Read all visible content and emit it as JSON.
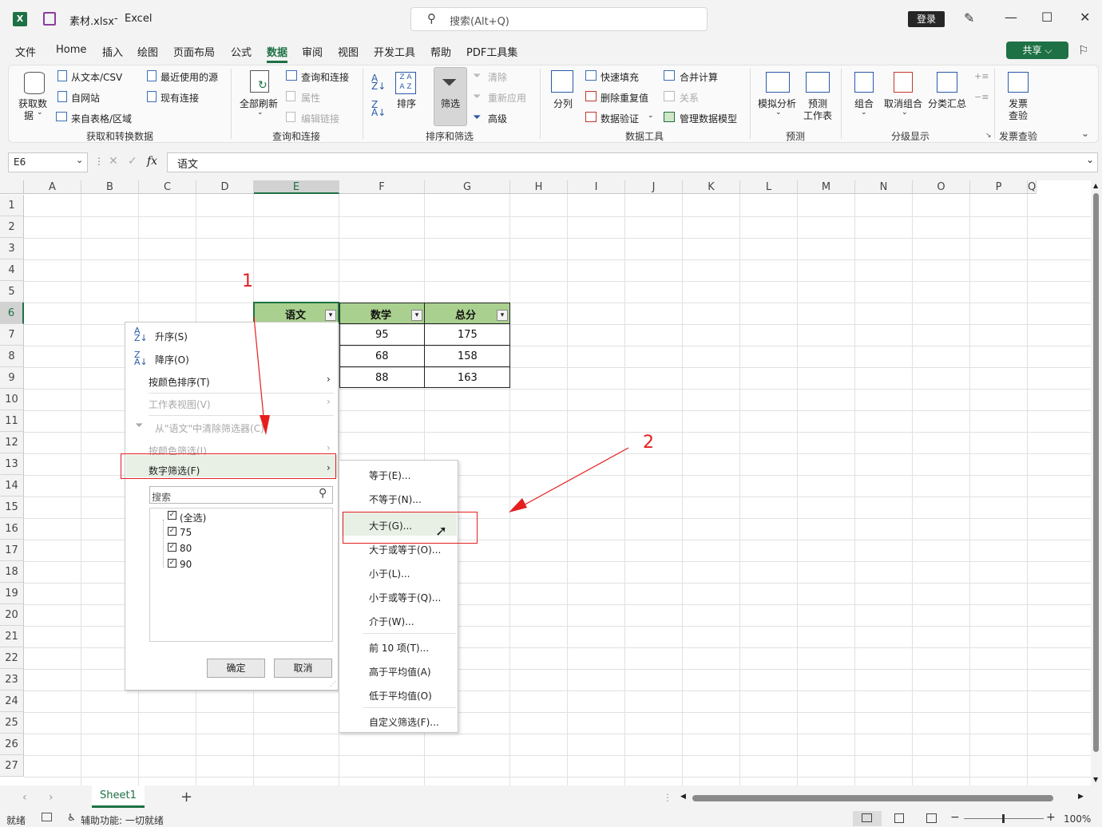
{
  "titlebar": {
    "filename": "素材.xlsx",
    "separator": "-",
    "app": "Excel",
    "search_placeholder": "搜索(Alt+Q)",
    "login": "登录"
  },
  "menu": [
    "文件",
    "Home",
    "插入",
    "绘图",
    "页面布局",
    "公式",
    "数据",
    "审阅",
    "视图",
    "开发工具",
    "帮助",
    "PDF工具集"
  ],
  "share": "共享",
  "ribbon": {
    "get_data": "获取数",
    "get_data2": "据",
    "from_text": "从文本/CSV",
    "from_web": "自网站",
    "from_table": "来自表格/区域",
    "recent_sources": "最近使用的源",
    "existing_conn": "现有连接",
    "group_get": "获取和转换数据",
    "refresh_all": "全部刷新",
    "queries_conn": "查询和连接",
    "properties": "属性",
    "edit_links": "编辑链接",
    "group_query": "查询和连接",
    "sort": "排序",
    "filter": "筛选",
    "clear": "清除",
    "reapply": "重新应用",
    "advanced": "高级",
    "group_sort": "排序和筛选",
    "text_to_col": "分列",
    "flash_fill": "快速填充",
    "remove_dup": "删除重复值",
    "data_valid": "数据验证",
    "consolidate": "合并计算",
    "relations": "关系",
    "manage_model": "管理数据模型",
    "group_tools": "数据工具",
    "what_if": "模拟分析",
    "forecast": "预测",
    "forecast2": "工作表",
    "group_forecast": "预测",
    "group_btn": "组合",
    "ungroup": "取消组合",
    "subtotal": "分类汇总",
    "group_outline": "分级显示",
    "invoice": "发票",
    "invoice2": "查验",
    "group_invoice": "发票查验"
  },
  "formula": {
    "cell_ref": "E6",
    "fx": "fx",
    "content": "语文"
  },
  "columns": [
    "A",
    "B",
    "C",
    "D",
    "E",
    "F",
    "G",
    "H",
    "I",
    "J",
    "K",
    "L",
    "M",
    "N",
    "O",
    "P",
    "Q"
  ],
  "rows": [
    "1",
    "2",
    "3",
    "4",
    "5",
    "6",
    "7",
    "8",
    "9",
    "10",
    "11",
    "12",
    "13",
    "14",
    "15",
    "16",
    "17",
    "18",
    "19",
    "20",
    "21",
    "22",
    "23",
    "24",
    "25",
    "26",
    "27"
  ],
  "table": {
    "headers": [
      "语文",
      "数学",
      "总分"
    ],
    "rows": [
      [
        "95",
        "175"
      ],
      [
        "68",
        "158"
      ],
      [
        "88",
        "163"
      ]
    ]
  },
  "panel": {
    "sort_asc": "升序(S)",
    "sort_desc": "降序(O)",
    "sort_color": "按颜色排序(T)",
    "sheet_view": "工作表视图(V)",
    "clear_filter": "从\"语文\"中清除筛选器(C)",
    "filter_color": "按颜色筛选(I)",
    "number_filter": "数字筛选(F)",
    "search_placeholder": "搜索",
    "items": [
      "(全选)",
      "75",
      "80",
      "90"
    ],
    "ok": "确定",
    "cancel": "取消"
  },
  "submenu": [
    "等于(E)...",
    "不等于(N)...",
    "大于(G)...",
    "大于或等于(O)...",
    "小于(L)...",
    "小于或等于(Q)...",
    "介于(W)...",
    "前 10 项(T)...",
    "高于平均值(A)",
    "低于平均值(O)",
    "自定义筛选(F)..."
  ],
  "annotations": {
    "label1": "1",
    "label2": "2",
    "color": "#e61e1e"
  },
  "sheet_tab": "Sheet1",
  "status": {
    "ready": "就绪",
    "accessibility": "辅助功能: 一切就绪",
    "zoom": "100%"
  },
  "colors": {
    "accent": "#1e7145",
    "header_fill": "#a9d08e"
  }
}
